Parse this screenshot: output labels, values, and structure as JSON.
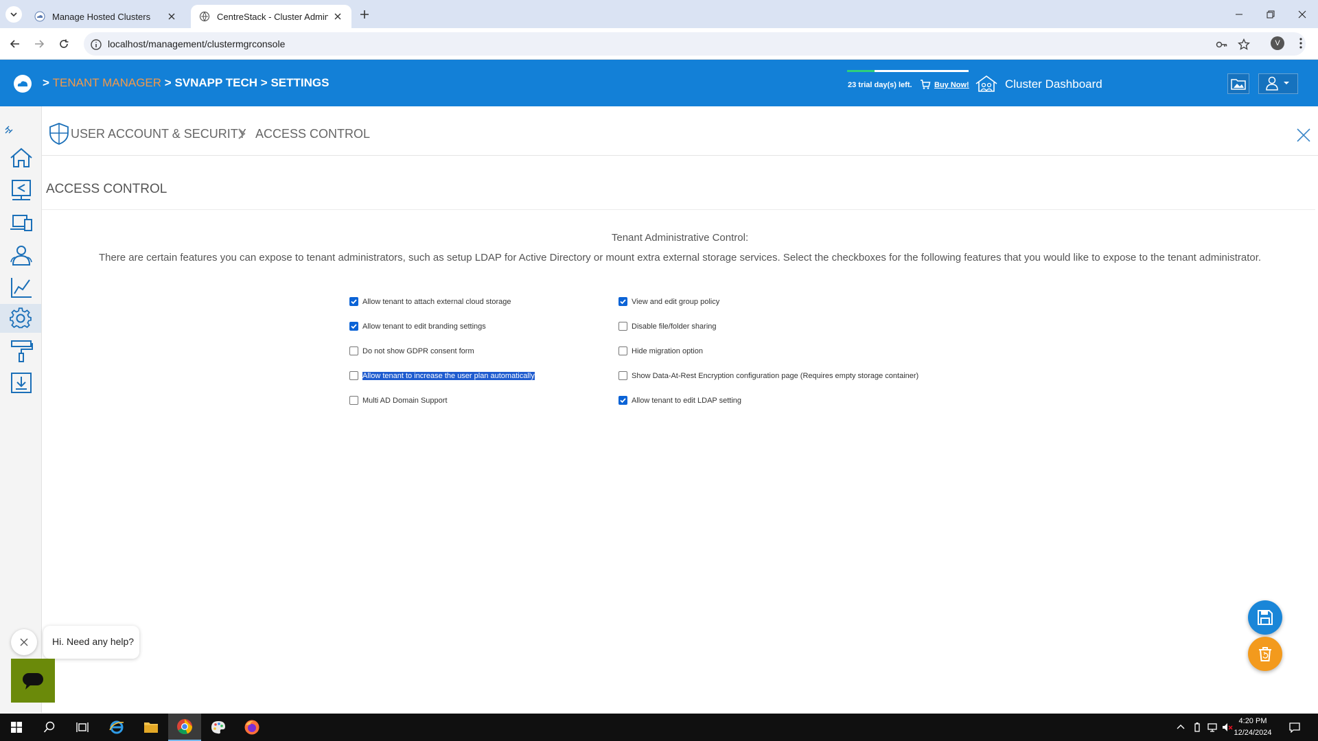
{
  "browser": {
    "tabs": [
      {
        "title": "Manage Hosted Clusters",
        "active": false
      },
      {
        "title": "CentreStack - Cluster Admin (sv",
        "active": true
      }
    ],
    "url": "localhost/management/clustermgrconsole",
    "profile_initial": "V"
  },
  "header": {
    "breadcrumb": {
      "sep1": ">",
      "tenant_manager": "TENANT MANAGER",
      "sep2": ">",
      "tenant": "SVNAPP TECH",
      "sep3": ">",
      "settings": "SETTINGS"
    },
    "trial_text": "23 trial day(s) left.",
    "buy_now": "Buy Now!",
    "cluster_dashboard": "Cluster Dashboard",
    "colors": {
      "header_bg": "#1380d7",
      "breadcrumb_accent": "#f2994a",
      "trial_progress": "#2fd07a"
    }
  },
  "rail": {
    "items": [
      "home-icon",
      "share-screen-icon",
      "devices-icon",
      "users-icon",
      "chart-icon",
      "settings-gear-icon",
      "paint-roller-icon",
      "download-icon"
    ],
    "active": "settings-gear-icon"
  },
  "page": {
    "breadcrumb_parent": "USER ACCOUNT & SECURITY",
    "breadcrumb_current": "ACCESS CONTROL",
    "section_title": "ACCESS CONTROL",
    "tac_title": "Tenant Administrative Control:",
    "tac_description": "There are certain features you can expose to tenant administrators, such as setup LDAP for Active Directory or mount extra external storage services. Select the checkboxes for the following features that you would like to expose to the tenant administrator.",
    "options_left": [
      {
        "label": "Allow tenant to attach external cloud storage",
        "checked": true
      },
      {
        "label": "Allow tenant to edit branding settings",
        "checked": true
      },
      {
        "label": "Do not show GDPR consent form",
        "checked": false
      },
      {
        "label": "Allow tenant to increase the user plan automatically",
        "checked": false,
        "selected_text": true
      },
      {
        "label": "Multi AD Domain Support",
        "checked": false
      }
    ],
    "options_right": [
      {
        "label": "View and edit group policy",
        "checked": true
      },
      {
        "label": "Disable file/folder sharing",
        "checked": false
      },
      {
        "label": "Hide migration option",
        "checked": false
      },
      {
        "label": "Show Data-At-Rest Encryption configuration page (Requires empty storage container)",
        "checked": false
      },
      {
        "label": "Allow tenant to edit LDAP setting",
        "checked": true
      }
    ]
  },
  "help": {
    "message": "Hi. Need any help?"
  },
  "taskbar": {
    "time": "4:20 PM",
    "date": "12/24/2024"
  }
}
